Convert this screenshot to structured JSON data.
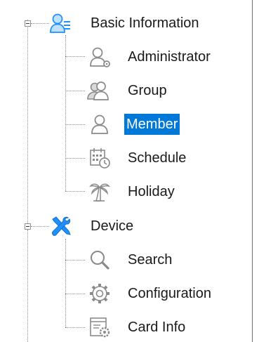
{
  "tree": [
    {
      "label": "Basic Information",
      "icon": "users-list-icon",
      "expanded": true,
      "children": [
        {
          "label": "Administrator",
          "icon": "admin-user-icon",
          "selected": false
        },
        {
          "label": "Group",
          "icon": "group-icon",
          "selected": false
        },
        {
          "label": "Member",
          "icon": "member-icon",
          "selected": true
        },
        {
          "label": "Schedule",
          "icon": "calendar-clock-icon",
          "selected": false
        },
        {
          "label": "Holiday",
          "icon": "palm-tree-icon",
          "selected": false
        }
      ]
    },
    {
      "label": "Device",
      "icon": "tools-icon",
      "expanded": true,
      "children": [
        {
          "label": "Search",
          "icon": "magnifier-icon",
          "selected": false
        },
        {
          "label": "Configuration",
          "icon": "gear-icon",
          "selected": false
        },
        {
          "label": "Card Info",
          "icon": "card-settings-icon",
          "selected": false
        }
      ]
    }
  ],
  "colors": {
    "selection": "#0078d7",
    "selection_text": "#ffffff",
    "accent_blue": "#1e90ff",
    "icon_gray": "#8a8a8a"
  }
}
